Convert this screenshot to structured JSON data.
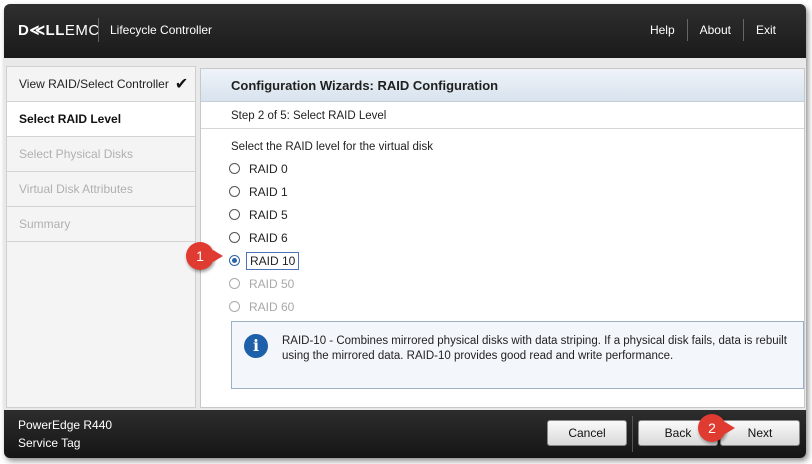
{
  "header": {
    "logo_bold": "D≪LL",
    "logo_rest": "EMC",
    "app_title": "Lifecycle Controller",
    "links": [
      "Help",
      "About",
      "Exit"
    ]
  },
  "sidebar": {
    "items": [
      {
        "label": "View RAID/Select Controller",
        "state": "done"
      },
      {
        "label": "Select RAID Level",
        "state": "active"
      },
      {
        "label": "Select Physical Disks",
        "state": "disabled"
      },
      {
        "label": "Virtual Disk Attributes",
        "state": "disabled"
      },
      {
        "label": "Summary",
        "state": "disabled"
      }
    ],
    "check_glyph": "✔"
  },
  "main": {
    "title": "Configuration Wizards: RAID Configuration",
    "step": "Step 2 of 5: Select RAID Level",
    "prompt": "Select the RAID level for the virtual disk",
    "options": [
      {
        "label": "RAID 0",
        "state": "enabled"
      },
      {
        "label": "RAID 1",
        "state": "enabled"
      },
      {
        "label": "RAID 5",
        "state": "enabled"
      },
      {
        "label": "RAID 6",
        "state": "enabled"
      },
      {
        "label": "RAID 10",
        "state": "selected"
      },
      {
        "label": "RAID 50",
        "state": "disabled"
      },
      {
        "label": "RAID 60",
        "state": "disabled"
      }
    ],
    "info_icon": "i",
    "info_text": "RAID-10 - Combines mirrored physical disks with data striping. If a physical disk fails, data is rebuilt using the mirrored data. RAID-10 provides good read and write performance."
  },
  "footer": {
    "model": "PowerEdge R440",
    "service_tag": "Service Tag",
    "cancel_label": "Cancel",
    "back_label": "Back",
    "next_label": "Next"
  },
  "callouts": [
    "1",
    "2"
  ],
  "colors": {
    "accent": "#2b63a8",
    "callout": "#e03b30",
    "header_bg": "#1a1a1a"
  }
}
